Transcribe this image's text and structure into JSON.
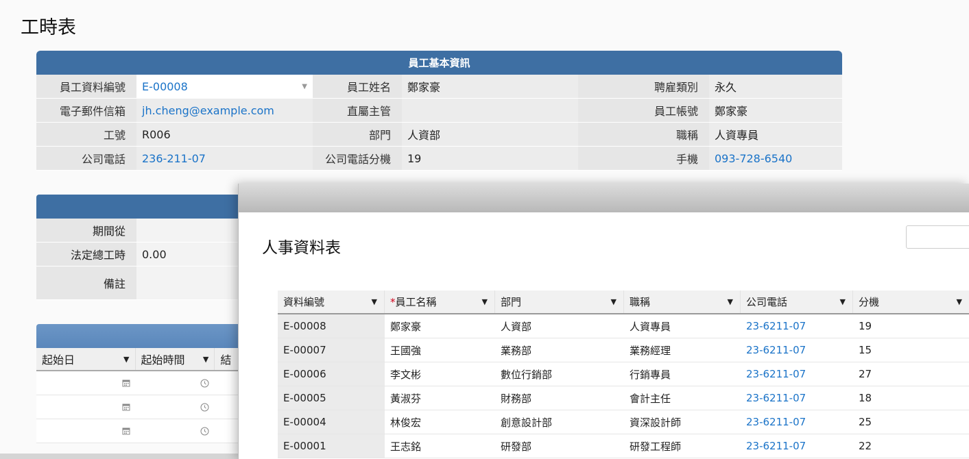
{
  "page": {
    "title": "工時表"
  },
  "employee_info": {
    "header": "員工基本資訊",
    "rows": [
      [
        {
          "label": "員工資料編號",
          "value": "E-00008",
          "link": true
        },
        {
          "label": "員工姓名",
          "value": "鄭家豪"
        },
        {
          "label": "聘雇類別",
          "value": "永久"
        }
      ],
      [
        {
          "label": "電子郵件信箱",
          "value": "jh.cheng@example.com",
          "link": true
        },
        {
          "label": "直屬主管",
          "value": ""
        },
        {
          "label": "員工帳號",
          "value": "鄭家豪"
        }
      ],
      [
        {
          "label": "工號",
          "value": "R006"
        },
        {
          "label": "部門",
          "value": "人資部"
        },
        {
          "label": "職稱",
          "value": "人資專員"
        }
      ],
      [
        {
          "label": "公司電話",
          "value": "236-211-07",
          "link": true
        },
        {
          "label": "公司電話分機",
          "value": "19"
        },
        {
          "label": "手機",
          "value": "093-728-6540",
          "link": true
        }
      ]
    ]
  },
  "period": {
    "rows": [
      {
        "label": "期間從",
        "value": ""
      },
      {
        "label": "法定總工時",
        "value": "0.00"
      },
      {
        "label": "備註",
        "value": ""
      }
    ]
  },
  "time_entries": {
    "columns": [
      "起始日",
      "起始時間",
      "結"
    ],
    "row_count": 3
  },
  "modal": {
    "title": "人事資料表",
    "columns": [
      {
        "label": "資料編號",
        "required": false
      },
      {
        "label": "員工名稱",
        "required": true
      },
      {
        "label": "部門",
        "required": false
      },
      {
        "label": "職稱",
        "required": false
      },
      {
        "label": "公司電話",
        "required": false
      },
      {
        "label": "分機",
        "required": false
      }
    ],
    "rows": [
      [
        "E-00008",
        "鄭家豪",
        "人資部",
        "人資專員",
        "23-6211-07",
        "19"
      ],
      [
        "E-00007",
        "王國強",
        "業務部",
        "業務經理",
        "23-6211-07",
        "15"
      ],
      [
        "E-00006",
        "李文彬",
        "數位行銷部",
        "行銷專員",
        "23-6211-07",
        "27"
      ],
      [
        "E-00005",
        "黃淑芬",
        "財務部",
        "會計主任",
        "23-6211-07",
        "18"
      ],
      [
        "E-00004",
        "林俊宏",
        "創意設計部",
        "資深設計師",
        "23-6211-07",
        "25"
      ],
      [
        "E-00001",
        "王志銘",
        "研發部",
        "研發工程師",
        "23-6211-07",
        "22"
      ]
    ]
  },
  "colors": {
    "header_blue": "#3e6fa3",
    "link": "#1a73c8",
    "required": "#d0021b"
  }
}
